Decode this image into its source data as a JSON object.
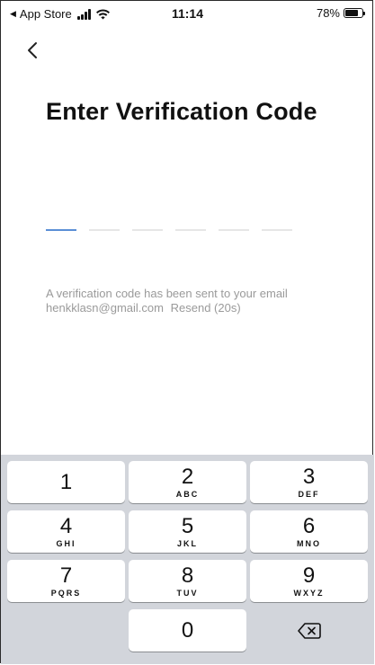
{
  "status_bar": {
    "back_app": "App Store",
    "time": "11:14",
    "battery_percent": "78%",
    "battery_level": 0.78,
    "icons": [
      "back-triangle-icon",
      "signal-icon",
      "wifi-icon",
      "battery-icon"
    ]
  },
  "nav": {
    "back_icon": "chevron-left-icon"
  },
  "screen": {
    "title": "Enter Verification Code",
    "code_length": 6,
    "info_line1": "A verification code has been sent to your email",
    "email": "henkklasn@gmail.com",
    "resend": "Resend (20s)",
    "accent_color": "#5b8fd6"
  },
  "keypad": {
    "keys": [
      {
        "num": "1",
        "letters": ""
      },
      {
        "num": "2",
        "letters": "ABC"
      },
      {
        "num": "3",
        "letters": "DEF"
      },
      {
        "num": "4",
        "letters": "GHI"
      },
      {
        "num": "5",
        "letters": "JKL"
      },
      {
        "num": "6",
        "letters": "MNO"
      },
      {
        "num": "7",
        "letters": "PQRS"
      },
      {
        "num": "8",
        "letters": "TUV"
      },
      {
        "num": "9",
        "letters": "WXYZ"
      },
      {
        "num": "0",
        "letters": ""
      }
    ],
    "backspace_icon": "backspace-icon"
  }
}
